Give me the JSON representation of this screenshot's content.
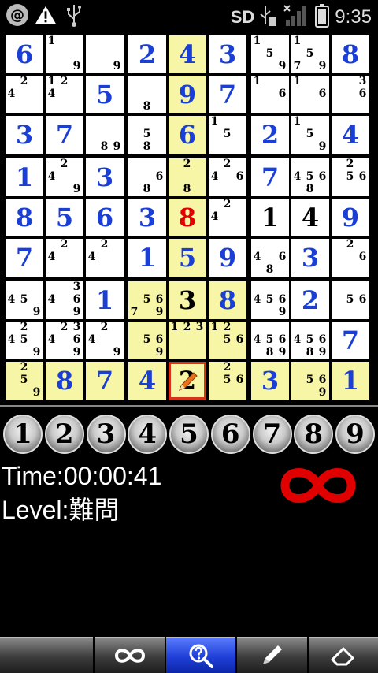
{
  "status_bar": {
    "left_icons": [
      "at-sign-icon",
      "warning-icon",
      "usb-icon"
    ],
    "sd_label": "SD",
    "right_icons": [
      "usb-debug-icon",
      "signal-off-icon",
      "battery-icon"
    ],
    "clock": "9:35"
  },
  "board": {
    "highlight_color": "#f7f5a6",
    "given_color": "#000000",
    "user_color": "#1a3fd6",
    "error_color": "#e00000",
    "selected_border_color": "#d8341a",
    "rows": [
      [
        {
          "u": "6"
        },
        {
          "n": [
            1,
            9
          ]
        },
        {
          "n": [
            9
          ]
        },
        {
          "u": "2"
        },
        {
          "u": "4",
          "h": 1
        },
        {
          "u": "3"
        },
        {
          "n": [
            1,
            5,
            9
          ]
        },
        {
          "n": [
            1,
            5,
            7,
            9
          ]
        },
        {
          "u": "8"
        }
      ],
      [
        {
          "n": [
            2,
            4
          ]
        },
        {
          "n": [
            1,
            2,
            4
          ]
        },
        {
          "u": "5"
        },
        {
          "n": [
            8
          ]
        },
        {
          "u": "9",
          "h": 1
        },
        {
          "u": "7"
        },
        {
          "n": [
            1,
            6
          ]
        },
        {
          "n": [
            1,
            6
          ]
        },
        {
          "n": [
            3,
            6
          ]
        }
      ],
      [
        {
          "u": "3"
        },
        {
          "u": "7"
        },
        {
          "n": [
            8,
            9
          ]
        },
        {
          "n": [
            5,
            8
          ]
        },
        {
          "u": "6",
          "h": 1
        },
        {
          "n": [
            1,
            5
          ]
        },
        {
          "u": "2"
        },
        {
          "n": [
            1,
            5,
            9
          ]
        },
        {
          "u": "4"
        }
      ],
      [
        {
          "u": "1"
        },
        {
          "n": [
            2,
            4,
            9
          ]
        },
        {
          "u": "3"
        },
        {
          "n": [
            6,
            8
          ]
        },
        {
          "n": [
            2,
            8
          ],
          "h": 1
        },
        {
          "n": [
            2,
            4,
            6
          ]
        },
        {
          "u": "7"
        },
        {
          "n": [
            4,
            5,
            6,
            8
          ]
        },
        {
          "n": [
            2,
            5,
            6
          ]
        }
      ],
      [
        {
          "u": "8"
        },
        {
          "u": "5"
        },
        {
          "u": "6"
        },
        {
          "u": "3"
        },
        {
          "e": "8",
          "h": 1
        },
        {
          "n": [
            2,
            4
          ]
        },
        {
          "g": "1"
        },
        {
          "g": "4"
        },
        {
          "u": "9"
        }
      ],
      [
        {
          "u": "7"
        },
        {
          "n": [
            2,
            4
          ]
        },
        {
          "n": [
            2,
            4
          ]
        },
        {
          "u": "1"
        },
        {
          "u": "5",
          "h": 1
        },
        {
          "u": "9"
        },
        {
          "n": [
            4,
            6,
            8
          ]
        },
        {
          "u": "3"
        },
        {
          "n": [
            2,
            6
          ]
        }
      ],
      [
        {
          "n": [
            4,
            5,
            9
          ]
        },
        {
          "n": [
            3,
            4,
            6,
            9
          ]
        },
        {
          "u": "1"
        },
        {
          "n": [
            5,
            6,
            7,
            9
          ],
          "h": 1
        },
        {
          "g": "3",
          "h": 1
        },
        {
          "u": "8",
          "h": 1
        },
        {
          "n": [
            4,
            5,
            6,
            9
          ]
        },
        {
          "u": "2"
        },
        {
          "n": [
            5,
            6
          ]
        }
      ],
      [
        {
          "n": [
            2,
            4,
            5,
            9
          ]
        },
        {
          "n": [
            2,
            3,
            4,
            6,
            9
          ]
        },
        {
          "n": [
            2,
            4,
            9
          ]
        },
        {
          "n": [
            5,
            6,
            9
          ],
          "h": 1
        },
        {
          "n": [
            1,
            2,
            3
          ],
          "h": 1
        },
        {
          "n": [
            1,
            2,
            5,
            6
          ],
          "h": 1
        },
        {
          "n": [
            4,
            5,
            6,
            8,
            9
          ]
        },
        {
          "n": [
            4,
            5,
            6,
            8,
            9
          ]
        },
        {
          "u": "7"
        }
      ],
      [
        {
          "n": [
            2,
            5,
            9
          ],
          "h": 1
        },
        {
          "u": "8",
          "h": 1
        },
        {
          "u": "7",
          "h": 1
        },
        {
          "u": "4",
          "h": 1
        },
        {
          "g": "2",
          "h": 1,
          "sel": 1
        },
        {
          "n": [
            2,
            5,
            6
          ],
          "h": 1
        },
        {
          "u": "3",
          "h": 1
        },
        {
          "n": [
            5,
            6,
            9
          ],
          "h": 1
        },
        {
          "u": "1",
          "h": 1
        }
      ]
    ]
  },
  "number_buttons": [
    "1",
    "2",
    "3",
    "4",
    "5",
    "6",
    "7",
    "8",
    "9"
  ],
  "info": {
    "time_label": "Time:00:00:41",
    "level_label": "Level:難問",
    "infinity_icon_color": "#e00000"
  },
  "toolbar": {
    "buttons": [
      {
        "icon": "blank-icon",
        "active": false
      },
      {
        "icon": "infinity-icon",
        "active": false
      },
      {
        "icon": "magnifier-hint-icon",
        "active": true
      },
      {
        "icon": "pencil-icon",
        "active": false
      },
      {
        "icon": "eraser-icon",
        "active": false
      }
    ]
  }
}
